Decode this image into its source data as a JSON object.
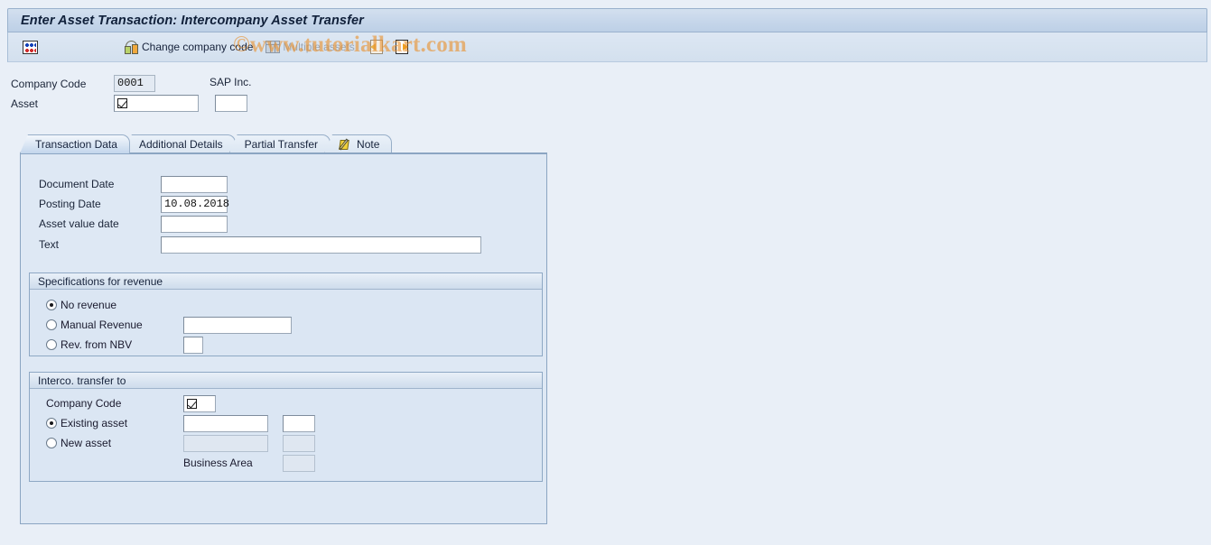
{
  "window": {
    "title": "Enter Asset Transaction: Intercompany Asset Transfer"
  },
  "watermark": {
    "text": "©www.tutorialkart.com"
  },
  "toolbar": {
    "abacus_icon": "abacus-icon",
    "change_company_code": "Change company code",
    "multiple_assets": "Multiple assets",
    "prev_asset_icon": "previous-asset-icon",
    "next_asset_icon": "next-asset-icon"
  },
  "header": {
    "company_code_label": "Company Code",
    "company_code_value": "0001",
    "company_name": "SAP Inc.",
    "asset_label": "Asset",
    "asset_value": "",
    "asset_subnumber_value": ""
  },
  "tabs": [
    {
      "label": "Transaction Data",
      "active": true,
      "icon": ""
    },
    {
      "label": "Additional Details",
      "active": false,
      "icon": ""
    },
    {
      "label": "Partial Transfer",
      "active": false,
      "icon": ""
    },
    {
      "label": "Note",
      "active": false,
      "icon": "note-pencil-icon"
    }
  ],
  "transaction_data": {
    "document_date_label": "Document Date",
    "document_date_value": "",
    "posting_date_label": "Posting Date",
    "posting_date_value": "10.08.2018",
    "asset_value_date_label": "Asset value date",
    "asset_value_date_value": "",
    "text_label": "Text",
    "text_value": ""
  },
  "revenue_group": {
    "title": "Specifications for revenue",
    "options": [
      {
        "label": "No revenue",
        "selected": true,
        "has_input": false,
        "value": ""
      },
      {
        "label": "Manual Revenue",
        "selected": false,
        "has_input": true,
        "value": ""
      },
      {
        "label": "Rev. from NBV",
        "selected": false,
        "has_input": true,
        "value": ""
      }
    ]
  },
  "transfer_group": {
    "title": "Interco. transfer to",
    "company_code_label": "Company Code",
    "company_code_value": "",
    "existing_asset_label": "Existing asset",
    "existing_asset_selected": true,
    "existing_asset_value": "",
    "existing_asset_sub_value": "",
    "new_asset_label": "New asset",
    "new_asset_selected": false,
    "new_asset_value": "",
    "new_asset_sub_value": "",
    "business_area_label": "Business Area",
    "business_area_value": ""
  },
  "colors": {
    "background": "#e9eff7",
    "panel": "#dee8f4",
    "accent_border": "#8ba5c2",
    "watermark": "#e9922e"
  }
}
